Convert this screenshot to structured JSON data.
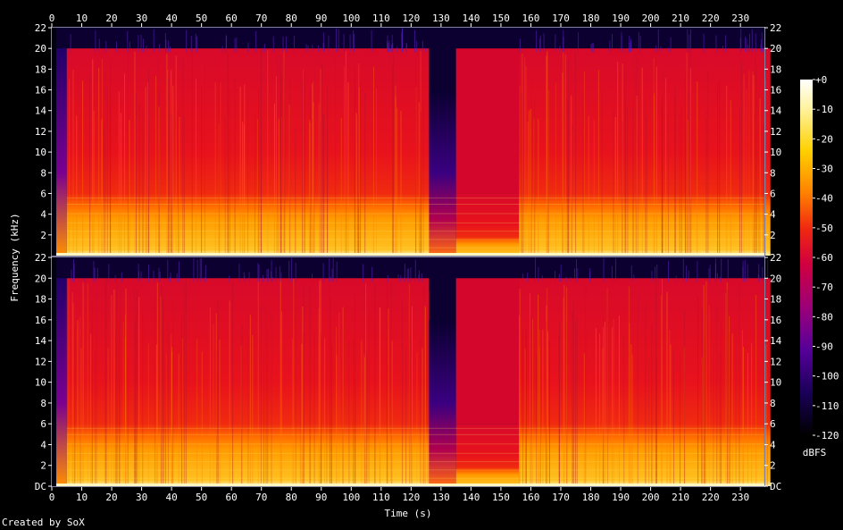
{
  "chart_data": {
    "type": "heatmap",
    "subtype": "spectrogram",
    "channels": 2,
    "xlabel": "Time (s)",
    "ylabel": "Frequency (kHz)",
    "xlim": [
      0,
      238
    ],
    "ylim": [
      0,
      22
    ],
    "x_ticks": [
      "0",
      "10",
      "20",
      "30",
      "40",
      "50",
      "60",
      "70",
      "80",
      "90",
      "100",
      "110",
      "120",
      "130",
      "140",
      "150",
      "160",
      "170",
      "180",
      "190",
      "200",
      "210",
      "220",
      "230"
    ],
    "y_ticks_top": [
      "22",
      "20",
      "18",
      "16",
      "14",
      "12",
      "10",
      "8",
      "6",
      "4",
      "2"
    ],
    "y_ticks_bottom": [
      "22",
      "20",
      "18",
      "16",
      "14",
      "12",
      "10",
      "8",
      "6",
      "4",
      "2",
      "DC"
    ],
    "colorbar": {
      "label": "dBFS",
      "ticks": [
        "+0",
        "-10",
        "-20",
        "-30",
        "-40",
        "-50",
        "-60",
        "-70",
        "-80",
        "-90",
        "-100",
        "-110",
        "-120"
      ],
      "range": [
        -120,
        0
      ],
      "colors": [
        "#000000",
        "#1a0050",
        "#50008c",
        "#a0007a",
        "#d8002a",
        "#ff4000",
        "#ffa000",
        "#ffe030",
        "#ffffff"
      ]
    },
    "content_cutoff_khz": 20,
    "segments": [
      {
        "t_start": 0,
        "t_end": 1.5,
        "level": "silence"
      },
      {
        "t_start": 1.5,
        "t_end": 5,
        "level": "fade-in"
      },
      {
        "t_start": 5,
        "t_end": 126,
        "level": "loud",
        "hf_cutoff_khz": 20
      },
      {
        "t_start": 126,
        "t_end": 135,
        "level": "quiet",
        "hf_cutoff_khz": 16
      },
      {
        "t_start": 135,
        "t_end": 156,
        "level": "lowpass",
        "hf_cutoff_khz": 6
      },
      {
        "t_start": 156,
        "t_end": 240,
        "level": "loud",
        "hf_cutoff_khz": 20
      }
    ]
  },
  "credit": "Created by SoX"
}
